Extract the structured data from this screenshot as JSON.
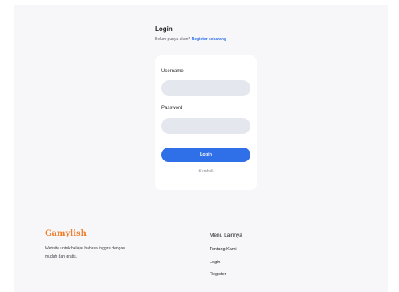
{
  "login": {
    "title": "Login",
    "subtitle_prefix": "Belum punya akun?",
    "register_link": "Register sekarang",
    "username_label": "Username",
    "username_value": "",
    "password_label": "Password",
    "password_value": "",
    "button_label": "Login",
    "back_label": "Kembali"
  },
  "footer": {
    "brand": "Gamylish",
    "description": "Website untuk belajar bahasa inggris dengan mudah dan gratis.",
    "menu_title": "Menu Lainnya",
    "menu_items": [
      {
        "label": "Tentang Kami"
      },
      {
        "label": "Login"
      },
      {
        "label": "Register"
      }
    ]
  },
  "colors": {
    "accent": "#2f6fe8",
    "brand": "#f07d2a",
    "input_bg": "#e5e7ee"
  }
}
